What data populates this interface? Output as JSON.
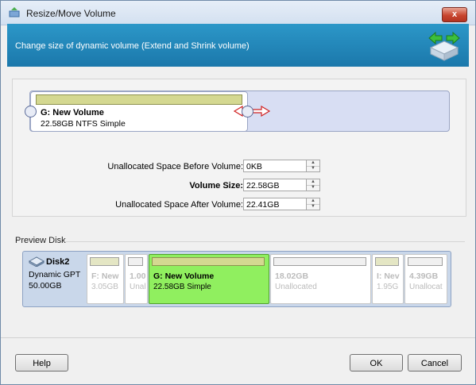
{
  "window": {
    "title": "Resize/Move Volume",
    "close_label": "x"
  },
  "header": {
    "text": "Change size of dynamic volume (Extend and Shrink volume)"
  },
  "volume": {
    "name": "G: New Volume",
    "info": "22.58GB NTFS Simple"
  },
  "fields": [
    {
      "label": "Unallocated Space Before Volume:",
      "value": "0KB"
    },
    {
      "label": "Volume Size:",
      "value": "22.58GB"
    },
    {
      "label": "Unallocated Space After Volume:",
      "value": "22.41GB"
    }
  ],
  "preview": {
    "label": "Preview Disk",
    "disk": {
      "name": "Disk2",
      "type": "Dynamic GPT",
      "size": "50.00GB"
    },
    "partitions": [
      {
        "name": "F: New",
        "info": "3.05GB"
      },
      {
        "name": "1.00",
        "info": "Unal"
      },
      {
        "name": "G: New Volume",
        "info": "22.58GB Simple"
      },
      {
        "name": "18.02GB",
        "info": "Unallocated"
      },
      {
        "name": "I: Nev",
        "info": "1.95G"
      },
      {
        "name": "4.39GB",
        "info": "Unallocat"
      }
    ]
  },
  "buttons": {
    "help": "Help",
    "ok": "OK",
    "cancel": "Cancel"
  },
  "colors": {
    "header": "#1e80b4",
    "active_partition": "#90ef5f",
    "volume_bar": "#d4d891"
  }
}
